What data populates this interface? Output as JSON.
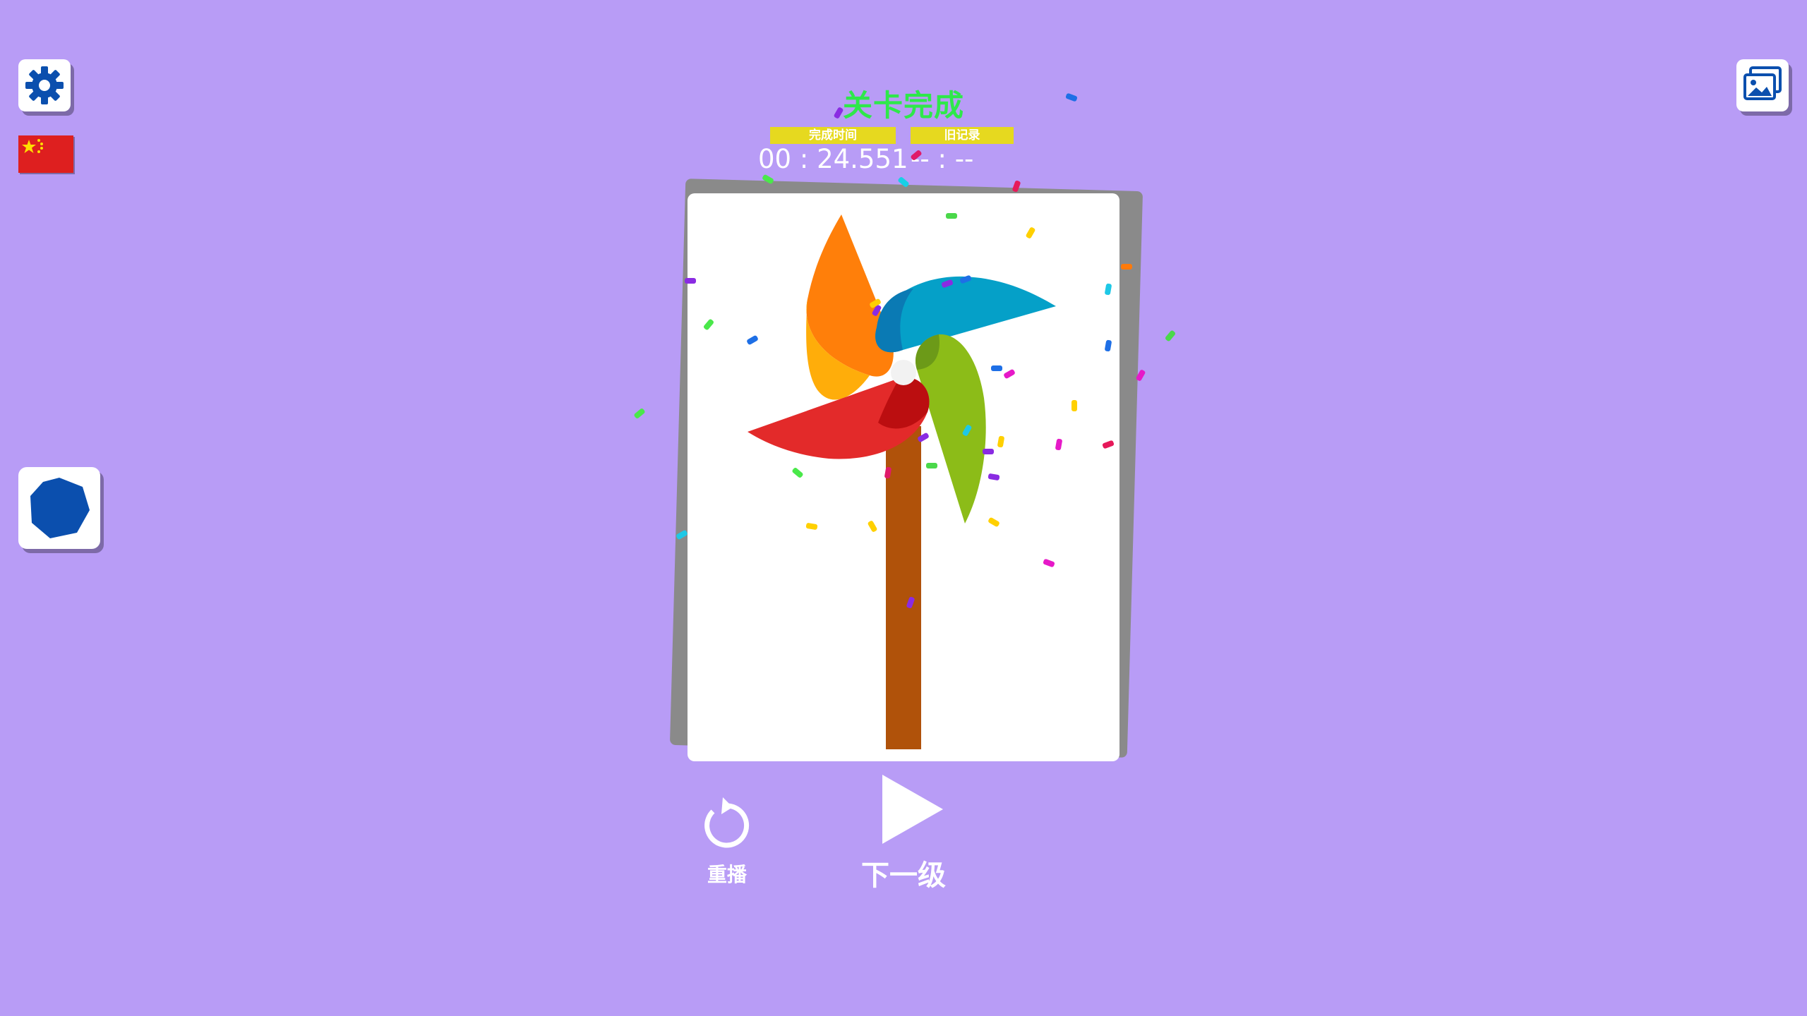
{
  "level": {
    "title": "关卡完成",
    "time_label": "完成时间",
    "time_value": "00 : 24.551",
    "record_label": "旧记录",
    "record_value": "-- : --"
  },
  "controls": {
    "replay_label": "重播",
    "next_label": "下一级"
  },
  "icons": {
    "settings": "gear-icon",
    "gallery": "gallery-icon",
    "language": "china-flag-icon",
    "shape": "octagon-icon",
    "replay": "replay-icon",
    "next": "play-icon"
  },
  "colors": {
    "background": "#b89cf6",
    "title_green": "#2ee84a",
    "label_yellow": "#e6d91f",
    "shape_blue": "#0b4fae",
    "settings_blue": "#0b4fae"
  },
  "artwork": {
    "subject": "pinwheel"
  }
}
